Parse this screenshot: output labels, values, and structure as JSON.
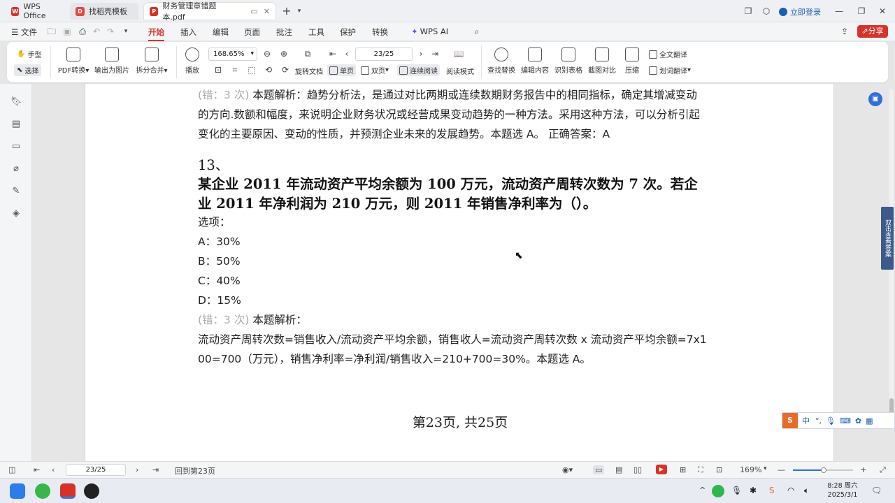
{
  "tabs": [
    {
      "label": "WPS Office",
      "icon": "wps-logo-icon",
      "color": "#d7322a"
    },
    {
      "label": "找稻壳模板",
      "icon": "docer-icon",
      "color": "#e5483f"
    },
    {
      "label": "财务管理章错题本.pdf",
      "icon": "pdf-icon",
      "color": "#d7322a"
    }
  ],
  "titlebar": {
    "login": "立即登录",
    "share": "分享"
  },
  "menu": [
    "文件",
    "开始",
    "插入",
    "编辑",
    "页面",
    "批注",
    "工具",
    "保护",
    "转换",
    "WPS AI"
  ],
  "menu_active": "开始",
  "ribbon": {
    "hand": "手型",
    "select": "选择",
    "pdf_convert": "PDF转换",
    "export_image": "输出为图片",
    "split_merge": "拆分合并",
    "play": "播放",
    "zoom": "168.65%",
    "page_field": "23/25",
    "rotate": "旋转文档",
    "single": "单页",
    "double": "双页",
    "continuous": "连续阅读",
    "read_mode": "阅读模式",
    "find_replace": "查找替换",
    "edit_content": "编辑内容",
    "recognize_table": "识别表格",
    "screenshot_compare": "截图对比",
    "compress": "压缩",
    "full_translate": "全文翻译",
    "word_translate": "划词翻译"
  },
  "content": {
    "prev_tag": "(错：3 次)",
    "prev_line1": " 本题解析：趋势分析法，是通过对比两期或连续数期财务报告中的相同指标，确定其增减变动",
    "prev_line2": "的方向.数额和幅度，来说明企业财务状况或经营成果变动趋势的一种方法。采用这种方法，可以分析引起",
    "prev_line3": "变化的主要原因、变动的性质，并预测企业未来的发展趋势。本题选 A。 正确答案：A",
    "q_number": "13、",
    "q_line1": "某企业 2011 年流动资产平均余额为 100 万元，流动资产周转次数为 7 次。若企",
    "q_line2": "业 2011 年净利润为 210 万元，则 2011 年销售净利率为（）。",
    "options_label": "选项：",
    "options": [
      "A：30%",
      "B：50%",
      "C：40%",
      "D：15%"
    ],
    "analysis_tag": "(错：3 次)",
    "analysis_label": " 本题解析：",
    "analysis_line1": "流动资产周转次数=销售收入/流动资产平均余额，销售收人=流动资产周转次数 x 流动资产平均余额=7x1",
    "analysis_line2": "00=700（万元），销售净利率=净利润/销售收入=210+700=30%。本题选 A。",
    "page_footer": "第23页, 共25页"
  },
  "statusbar": {
    "page": "23/25",
    "goto": "回到第23页",
    "zoom": "169%"
  },
  "ime": {
    "label": "中"
  },
  "side_widget": "双击查看答案",
  "clock": {
    "time": "8:28 周六",
    "date": "2025/3/1"
  },
  "colors": {
    "accent": "#d7322a",
    "link": "#1a5fb4"
  }
}
